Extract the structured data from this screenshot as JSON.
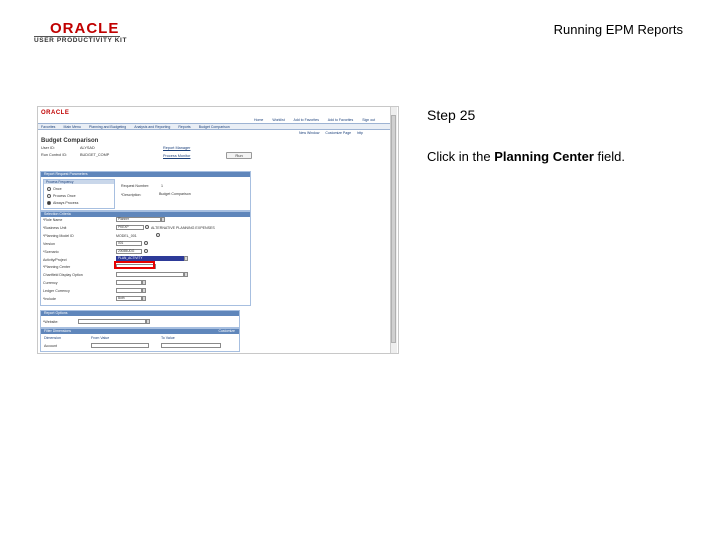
{
  "header": {
    "logo_text": "ORACLE",
    "logo_sub": "USER PRODUCTIVITY KIT",
    "title": "Running EPM Reports"
  },
  "step": {
    "title": "Step 25",
    "text_before": "Click in the ",
    "text_bold": "Planning Center",
    "text_after": " field."
  },
  "screenshot": {
    "logo": "ORACLE",
    "top_links": [
      "Home",
      "Worklist",
      "Add to Favorites",
      "Add to Favorites",
      "Sign out"
    ],
    "nav": [
      "Favorites",
      "Main Menu",
      "Planning and Budgeting",
      "Analysis and Reporting",
      "Reports",
      "Budget Comparison"
    ],
    "tools": [
      "New Window",
      "Customize Page",
      "http"
    ],
    "page_title": "Budget Comparison",
    "user_id_label": "User ID:",
    "user_id_value": "ALYSAD",
    "run_control_label": "Run Control ID:",
    "run_control_value": "BUDGET_COMP",
    "report_manager": "Report Manager",
    "process_monitor": "Process Monitor",
    "run_button": "Run",
    "group_report_request": "Report Request Parameters",
    "group_process_frequency": "Process Frequency",
    "freq_options": [
      "Once",
      "Process Once",
      "Always Process"
    ],
    "request_number_label": "Request Number:",
    "request_number_value": "1",
    "description_label": "*Description:",
    "description_value": "Budget Comparison",
    "group_selection": "Selection Criteria",
    "fields": [
      {
        "label": "*Role Name",
        "value": "Planner"
      },
      {
        "label": "*Business Unit",
        "value": "PKEXP"
      },
      {
        "label": "*Planning Model ID",
        "value": "MODEL_001"
      },
      {
        "label": "Version",
        "value": "001"
      },
      {
        "label": "*Scenario",
        "value": "2008BUDG"
      },
      {
        "label": "Activity/Project",
        "value": "PLAN_ACTIVITY"
      },
      {
        "label": "*Planning Center",
        "value": ""
      },
      {
        "label": "Chartfield Display Option",
        "value": ""
      },
      {
        "label": "Currency",
        "value": ""
      },
      {
        "label": "Ledger Currency",
        "value": ""
      },
      {
        "label": "*Include",
        "value": "Both"
      }
    ],
    "bu_desc": "ALTERNATIVE PLANNING EXPENSES",
    "group_report": "Report Options",
    "website_label": "*Website:",
    "group_filter": "Filter Dimensions",
    "filter_cols": [
      "Dimension",
      "From Value",
      "To Value"
    ],
    "filter_customize": "Customize",
    "filter_row": "Account"
  }
}
